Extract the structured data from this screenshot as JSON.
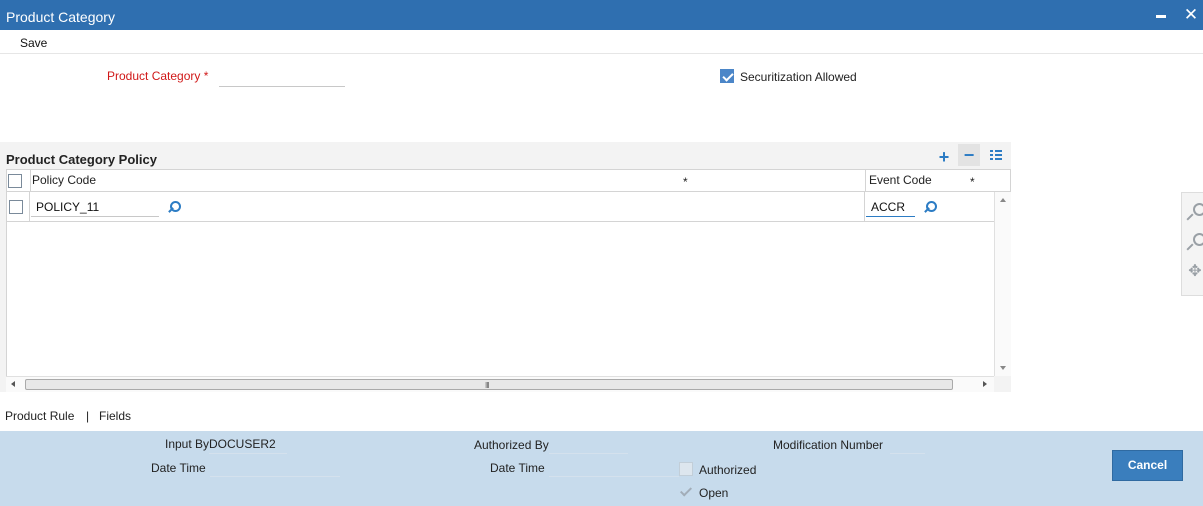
{
  "window": {
    "title": "Product Category",
    "minimize_icon": "minimize-icon",
    "close_icon": "close-icon",
    "close_glyph": "✕"
  },
  "toolbar": {
    "save_label": "Save"
  },
  "form": {
    "product_category_label": "Product Category",
    "required_mark": "*",
    "product_category_value": "",
    "securitization_label": "Securitization Allowed",
    "securitization_checked": true
  },
  "grid": {
    "title": "Product Category Policy",
    "add_glyph": "+",
    "remove_glyph": "−",
    "columns": {
      "policy_code": "Policy Code",
      "event_code": "Event Code",
      "required_mark": "*"
    },
    "rows": [
      {
        "checked": false,
        "policy_code": "POLICY_11",
        "event_code": "ACCR"
      }
    ],
    "hscroll_grip": "III"
  },
  "footer": {
    "product_rule": "Product Rule",
    "separator": "|",
    "fields": "Fields"
  },
  "audit": {
    "input_by_label": "Input By",
    "input_by_value": "DOCUSER2",
    "date_time_label": "Date Time",
    "authorized_by_label": "Authorized By",
    "authorized_date_time_label": "Date Time",
    "modification_number_label": "Modification Number",
    "authorized_label": "Authorized",
    "open_label": "Open",
    "authorized_checked": false,
    "open_checked": true,
    "cancel_label": "Cancel"
  },
  "colors": {
    "title_bar": "#2f6fb0",
    "required": "#d01818",
    "accent": "#2c7cc4",
    "audit_panel": "#c7dbec",
    "cancel_button": "#3a7ebd"
  }
}
